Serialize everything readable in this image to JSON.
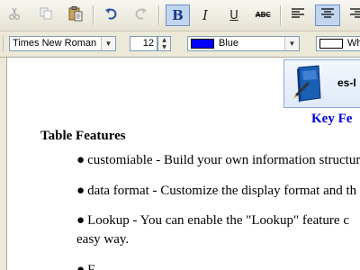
{
  "toolbar": {
    "buttons": [
      {
        "name": "cut-button",
        "icon": "scissors-icon",
        "state": "disabled"
      },
      {
        "name": "copy-button",
        "icon": "copy-icon",
        "state": "disabled"
      },
      {
        "name": "paste-button",
        "icon": "paste-icon",
        "state": "enabled"
      },
      {
        "name": "undo-button",
        "icon": "undo-icon",
        "state": "enabled"
      },
      {
        "name": "redo-button",
        "icon": "redo-icon",
        "state": "disabled"
      },
      {
        "name": "bold-button",
        "glyph": "B",
        "state": "active"
      },
      {
        "name": "italic-button",
        "glyph": "I",
        "state": "enabled"
      },
      {
        "name": "underline-button",
        "glyph": "U",
        "state": "enabled"
      },
      {
        "name": "strikethrough-button",
        "glyph": "ABC",
        "state": "enabled"
      },
      {
        "name": "align-left-button",
        "icon": "align-left-icon",
        "state": "enabled"
      },
      {
        "name": "align-center-button",
        "icon": "align-center-icon",
        "state": "active"
      },
      {
        "name": "align-right-button",
        "icon": "align-right-icon",
        "state": "enabled"
      }
    ]
  },
  "format_bar": {
    "font_family": "Times New Roman",
    "font_size": "12",
    "font_color_label": "Blue",
    "font_color": "#0000ff",
    "bg_color_label": "Wh"
  },
  "document": {
    "logo_text": "es-I",
    "key_heading": "Key Fe",
    "section_title": "Table Features",
    "bullets": [
      {
        "text": "customiable - Build your own information structur"
      },
      {
        "text": "data format - Customize the display format and th"
      },
      {
        "text": "Lookup  - You can enable the \"Lookup\" feature c",
        "continuation": "easy way."
      },
      {
        "text": "F"
      }
    ]
  },
  "colors": {
    "accent_blue": "#0000dd",
    "toolbar_bg": "#ece9d8",
    "active_button": "#c1d6ee"
  }
}
